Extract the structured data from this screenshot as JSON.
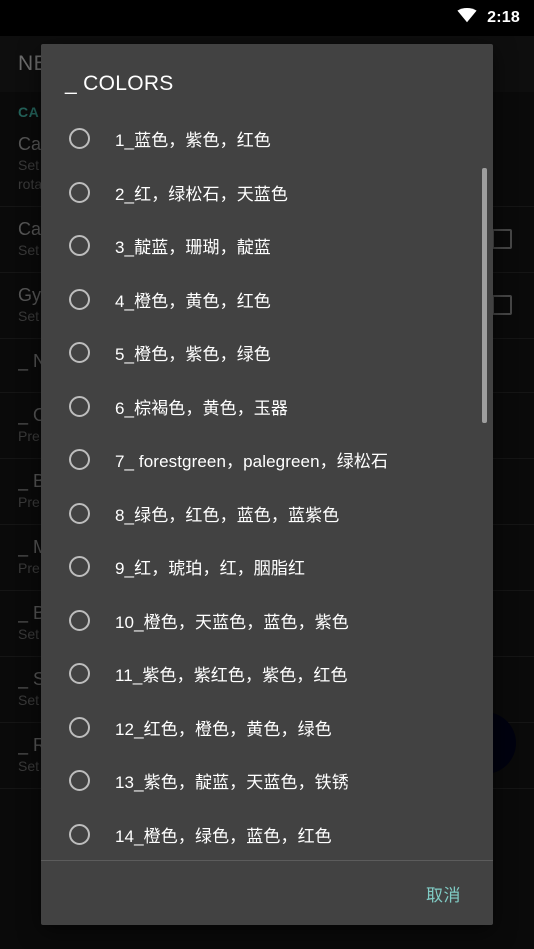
{
  "status_bar": {
    "wifi_icon": "wifi-icon",
    "time": "2:18"
  },
  "background_screen": {
    "appbar_title": "NE",
    "category_label": "CA",
    "rows": [
      {
        "title": "Ca",
        "sub": "Set",
        "sub2": "rota",
        "checkbox": false
      },
      {
        "title": "Ca",
        "sub": "Set",
        "sub2": "",
        "checkbox": true
      },
      {
        "title": "Gy",
        "sub": "Set",
        "sub2": "",
        "checkbox": true
      },
      {
        "title": "_ N",
        "sub": "",
        "sub2": "",
        "checkbox": false
      },
      {
        "title": "_ O",
        "sub": "Pre",
        "sub2": "",
        "checkbox": false
      },
      {
        "title": "_ B",
        "sub": "Pre",
        "sub2": "",
        "checkbox": false
      },
      {
        "title": "_ M",
        "sub": "Pre",
        "sub2": "",
        "checkbox": false
      },
      {
        "title": "_ B",
        "sub": "Set",
        "sub2": "",
        "checkbox": false
      },
      {
        "title": "_ S",
        "sub": "Set",
        "sub2": "",
        "checkbox": false
      },
      {
        "title": "_ R",
        "sub": "Set",
        "sub2": "",
        "checkbox": false
      }
    ]
  },
  "dialog": {
    "title": "_ COLORS",
    "options": [
      {
        "label": "1_蓝色，紫色，红色",
        "selected": false
      },
      {
        "label": "2_红，绿松石，天蓝色",
        "selected": false
      },
      {
        "label": "3_靛蓝，珊瑚，靛蓝",
        "selected": false
      },
      {
        "label": "4_橙色，黄色，红色",
        "selected": false
      },
      {
        "label": "5_橙色，紫色，绿色",
        "selected": false
      },
      {
        "label": "6_棕褐色，黄色，玉器",
        "selected": false
      },
      {
        "label": "7_ forestgreen，palegreen，绿松石",
        "selected": false
      },
      {
        "label": "8_绿色，红色，蓝色，蓝紫色",
        "selected": false
      },
      {
        "label": "9_红，琥珀，红，胭脂红",
        "selected": false
      },
      {
        "label": "10_橙色，天蓝色，蓝色，紫色",
        "selected": false
      },
      {
        "label": "11_紫色，紫红色，紫色，红色",
        "selected": false
      },
      {
        "label": "12_红色，橙色，黄色，绿色",
        "selected": false
      },
      {
        "label": "13_紫色，靛蓝，天蓝色，铁锈",
        "selected": false
      },
      {
        "label": "14_橙色，绿色，蓝色，红色",
        "selected": false
      }
    ],
    "cancel_label": "取消"
  },
  "colors": {
    "dialog_surface": "#424242",
    "accent_teal": "#80cbc4",
    "category_teal": "#2e7d72",
    "screen_background": "#0e0e0e",
    "status_bar_background": "#000000",
    "radio_ring": "#bdbdbd",
    "scrollbar_thumb": "#9e9e9e"
  }
}
